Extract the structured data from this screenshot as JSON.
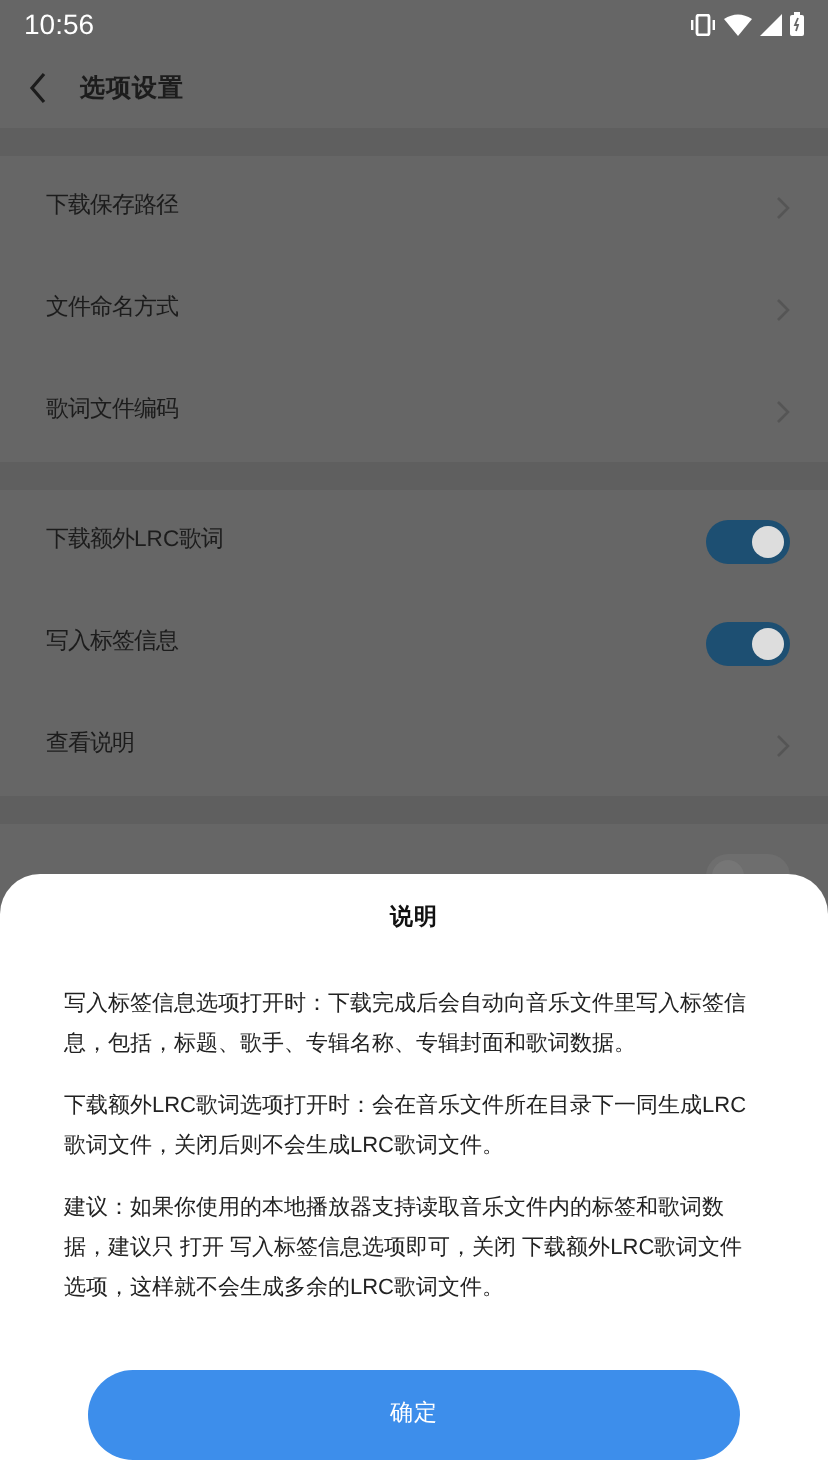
{
  "status_bar": {
    "time": "10:56"
  },
  "header": {
    "title": "选项设置"
  },
  "groups": [
    {
      "items": [
        {
          "kind": "link",
          "label": "下载保存路径"
        },
        {
          "kind": "link",
          "label": "文件命名方式"
        },
        {
          "kind": "link",
          "label": "歌词文件编码"
        }
      ]
    },
    {
      "items": [
        {
          "kind": "toggle",
          "label": "下载额外LRC歌词",
          "on": true
        },
        {
          "kind": "toggle",
          "label": "写入标签信息",
          "on": true
        },
        {
          "kind": "link",
          "label": "查看说明"
        }
      ]
    },
    {
      "items": [
        {
          "kind": "toggle",
          "on": false
        }
      ]
    }
  ],
  "dialog": {
    "title": "说明",
    "paragraphs": [
      "写入标签信息选项打开时：下载完成后会自动向音乐文件里写入标签信息，包括，标题、歌手、专辑名称、专辑封面和歌词数据。",
      "下载额外LRC歌词选项打开时：会在音乐文件所在目录下一同生成LRC歌词文件，关闭后则不会生成LRC歌词文件。",
      "建议：如果你使用的本地播放器支持读取音乐文件内的标签和歌词数据，建议只 打开 写入标签信息选项即可，关闭 下载额外LRC歌词文件选项，这样就不会生成多余的LRC歌词文件。"
    ],
    "button": "确定"
  }
}
